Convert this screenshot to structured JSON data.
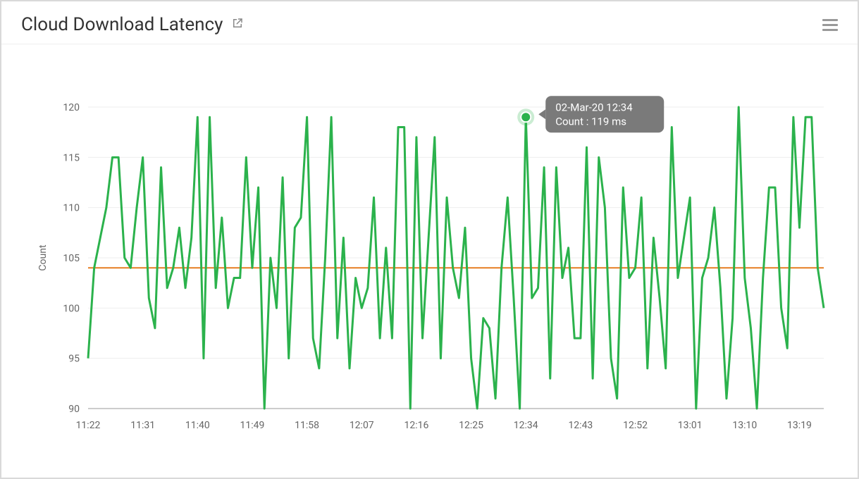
{
  "header": {
    "title": "Cloud Download Latency"
  },
  "tooltip": {
    "line1": "02-Mar-20 12:34",
    "line2": "Count : 119 ms",
    "x_value": "12:34",
    "y_value": 119
  },
  "chart_data": {
    "type": "line",
    "title": "Cloud Download Latency",
    "xlabel": "",
    "ylabel": "Count",
    "ylim": [
      90,
      120
    ],
    "y_ticks": [
      90,
      95,
      100,
      105,
      110,
      115,
      120
    ],
    "x_ticks": [
      "11:22",
      "11:31",
      "11:40",
      "11:49",
      "11:58",
      "12:07",
      "12:16",
      "12:25",
      "12:34",
      "12:43",
      "12:52",
      "13:01",
      "13:10",
      "13:19"
    ],
    "reference_line": 104,
    "series": [
      {
        "name": "Count",
        "color": "#2bb24c",
        "x": [
          "11:22",
          "11:23",
          "11:24",
          "11:25",
          "11:26",
          "11:27",
          "11:28",
          "11:29",
          "11:30",
          "11:31",
          "11:32",
          "11:33",
          "11:34",
          "11:35",
          "11:36",
          "11:37",
          "11:38",
          "11:39",
          "11:40",
          "11:41",
          "11:42",
          "11:43",
          "11:44",
          "11:45",
          "11:46",
          "11:47",
          "11:48",
          "11:49",
          "11:50",
          "11:51",
          "11:52",
          "11:53",
          "11:54",
          "11:55",
          "11:56",
          "11:57",
          "11:58",
          "11:59",
          "12:00",
          "12:01",
          "12:02",
          "12:03",
          "12:04",
          "12:05",
          "12:06",
          "12:07",
          "12:08",
          "12:09",
          "12:10",
          "12:11",
          "12:12",
          "12:13",
          "12:14",
          "12:15",
          "12:16",
          "12:17",
          "12:18",
          "12:19",
          "12:20",
          "12:21",
          "12:22",
          "12:23",
          "12:24",
          "12:25",
          "12:26",
          "12:27",
          "12:28",
          "12:29",
          "12:30",
          "12:31",
          "12:32",
          "12:33",
          "12:34",
          "12:35",
          "12:36",
          "12:37",
          "12:38",
          "12:39",
          "12:40",
          "12:41",
          "12:42",
          "12:43",
          "12:44",
          "12:45",
          "12:46",
          "12:47",
          "12:48",
          "12:49",
          "12:50",
          "12:51",
          "12:52",
          "12:53",
          "12:54",
          "12:55",
          "12:56",
          "12:57",
          "12:58",
          "12:59",
          "13:00",
          "13:01",
          "13:02",
          "13:03",
          "13:04",
          "13:05",
          "13:06",
          "13:07",
          "13:08",
          "13:09",
          "13:10",
          "13:11",
          "13:12",
          "13:13",
          "13:14",
          "13:15",
          "13:16",
          "13:17",
          "13:18",
          "13:19",
          "13:20",
          "13:21",
          "13:22",
          "13:23"
        ],
        "values": [
          95,
          104,
          107,
          110,
          115,
          115,
          105,
          104,
          110,
          115,
          101,
          98,
          114,
          102,
          104,
          108,
          102,
          107,
          119,
          95,
          119,
          102,
          109,
          100,
          103,
          103,
          115,
          104,
          112,
          90,
          105,
          100,
          113,
          95,
          108,
          109,
          119,
          97,
          94,
          105,
          119,
          97,
          107,
          94,
          103,
          100,
          102,
          111,
          97,
          106,
          97,
          118,
          118,
          90,
          117,
          97,
          107,
          117,
          95,
          111,
          104,
          101,
          108,
          95,
          90,
          99,
          98,
          91,
          104,
          111,
          101,
          90,
          119,
          101,
          102,
          114,
          93,
          114,
          103,
          106,
          97,
          97,
          116,
          93,
          115,
          110,
          95,
          91,
          112,
          103,
          104,
          111,
          94,
          107,
          101,
          94,
          118,
          103,
          107,
          111,
          90,
          103,
          105,
          110,
          102,
          91,
          99,
          120,
          103,
          98,
          90,
          103,
          112,
          112,
          100,
          96,
          119,
          108,
          119,
          119,
          104,
          100
        ]
      }
    ]
  }
}
